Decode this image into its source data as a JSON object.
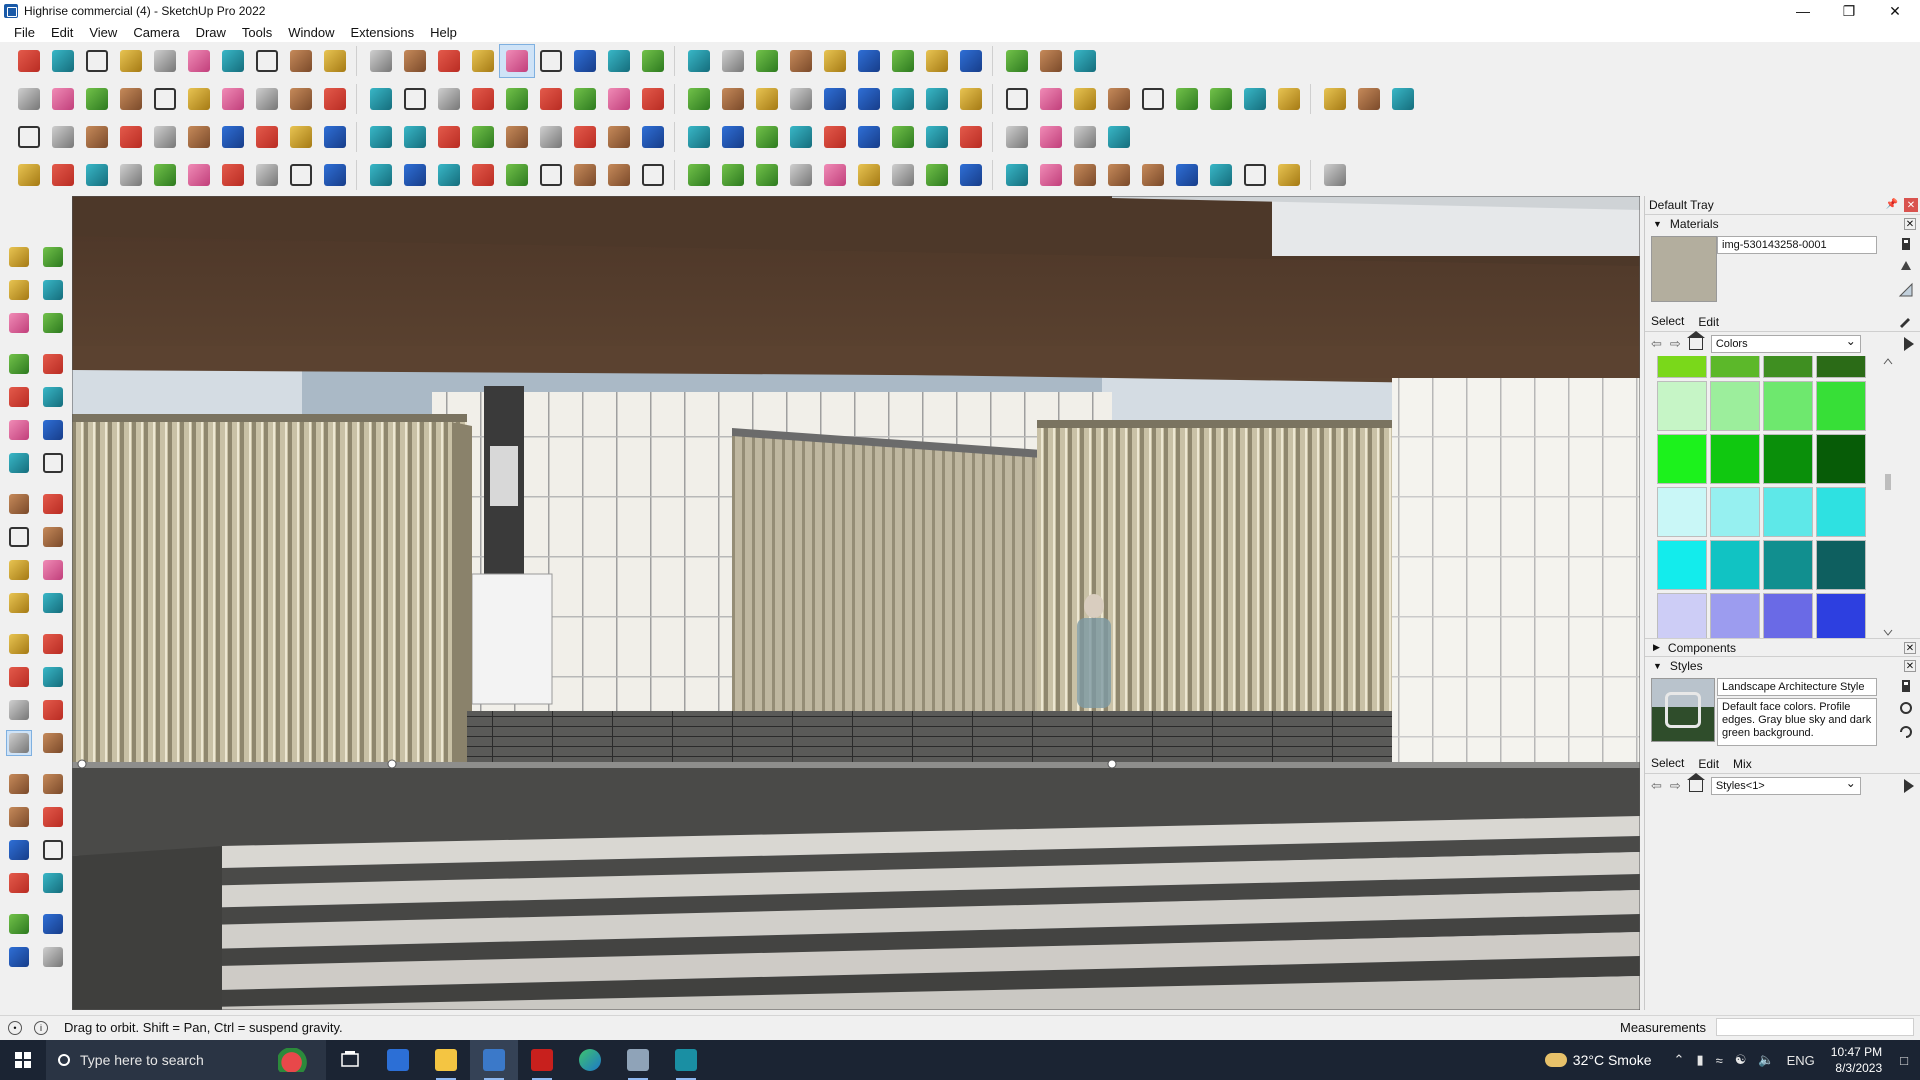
{
  "window": {
    "title": "Highrise commercial (4) - SketchUp Pro 2022",
    "controls": [
      "—",
      "❐",
      "✕"
    ]
  },
  "menu": [
    "File",
    "Edit",
    "View",
    "Camera",
    "Draw",
    "Tools",
    "Window",
    "Extensions",
    "Help"
  ],
  "toolbars": {
    "row1": [
      "zoom-icon",
      "select-icon",
      "eraser-icon",
      "pencil-icon",
      "lasso-icon",
      "paint-icon",
      "push-pull-icon",
      "follow-me-icon",
      "move-icon",
      "rotate-icon",
      "scale-icon",
      "tape-icon",
      "text-icon",
      "paint-bucket-icon",
      "orbit-icon",
      "pan-icon",
      "zoom-window-icon",
      "zoom-extents-icon",
      "section-icon",
      "layers-icon",
      "match-photo-icon",
      "sandbox-icon",
      "profile-icon",
      "component-icon",
      "group-icon",
      "flip-icon",
      "intersect-icon",
      "solid-icon",
      "undo-icon",
      "redo-icon",
      "warehouse-icon"
    ],
    "row2": [
      "iso-view-icon",
      "top-view-icon",
      "front-view-icon",
      "right-view-icon",
      "back-view-icon",
      "left-view-icon",
      "bottom-view-icon",
      "shade-icon",
      "xray-icon",
      "wire-icon",
      "hidden-icon",
      "shaded-icon",
      "textured-icon",
      "monochrome-icon",
      "move-arrow-icon",
      "axes-icon",
      "section-plane-icon",
      "house-icon",
      "roof-icon",
      "wall-icon",
      "door-icon",
      "window-icon",
      "stair-icon",
      "material-icon",
      "style-icon",
      "shadow-icon",
      "fog-icon",
      "render-icon",
      "extension-icon",
      "brush-icon",
      "shapes-icon",
      "polygon-icon",
      "circle-icon",
      "ellipse-icon",
      "parallelogram-icon",
      "arc-icon",
      "spiral-icon",
      "tag-icon",
      "link-icon",
      "draw-line-icon"
    ],
    "row3": [
      "box-icon",
      "plane-icon",
      "slab-icon",
      "beam-icon",
      "panel-icon",
      "loop-icon",
      "frame-icon",
      "door-frame-icon",
      "furniture-icon",
      "curve-icon",
      "bezier-icon",
      "add-icon",
      "weld-icon",
      "cone-icon",
      "tent-icon",
      "triangle-icon",
      "lasso-tool-icon",
      "ring-icon",
      "array-icon",
      "bucket-icon",
      "undo-arc-icon",
      "texture-icon",
      "camera-icon",
      "explode-icon",
      "label-icon",
      "grid-icon",
      "window-frame-icon",
      "tile-icon",
      "tile2-icon",
      "cross-icon",
      "arc-path-icon",
      "matrix-icon"
    ],
    "row4": [
      "spline-icon",
      "line-chain-icon",
      "car-icon",
      "scissors-icon",
      "gear-icon",
      "cloud-icon",
      "coil-icon",
      "drape-icon",
      "sphere-icon",
      "split-icon",
      "corner-icon",
      "stair-up-icon",
      "line-tool-icon",
      "curve-tool-icon",
      "stair-case-icon",
      "cut-icon",
      "columns-icon",
      "comb-icon",
      "paw-icon",
      "leaf-icon",
      "arrow-left-icon",
      "stairs2-icon",
      "slope-icon",
      "forks-icon",
      "forks2-icon",
      "fence-icon",
      "wall-hatch-icon",
      "wall2-icon",
      "louvre-icon",
      "hatch-icon",
      "grid-fence-icon",
      "louvre2-icon",
      "rail-icon",
      "wheel-icon",
      "wheel2-icon",
      "brush2-icon",
      "forks3-icon",
      "globe-icon"
    ]
  },
  "left_palette": [
    [
      "select-icon",
      "orbit-icon"
    ],
    [
      "paint-icon",
      "eraser-icon"
    ],
    [
      "component-icon",
      "tag-icon"
    ],
    [
      "line-icon",
      "freehand-icon"
    ],
    [
      "rectangle-icon",
      "rotated-rect-icon"
    ],
    [
      "circle-icon",
      "polygon-icon"
    ],
    [
      "arc-icon",
      "arc2-icon"
    ],
    [
      "pie-icon",
      "arc3-icon"
    ],
    [
      "move-icon",
      "push-pull-icon"
    ],
    [
      "rotate-icon",
      "follow-me-icon"
    ],
    [
      "scale-icon",
      "offset-icon"
    ],
    [
      "tape-icon",
      "dimension-icon"
    ],
    [
      "protractor-icon",
      "text-icon"
    ],
    [
      "axes-icon",
      "3d-text-icon"
    ],
    [
      "orbit-active-icon",
      "pan-icon"
    ],
    [
      "zoom-icon",
      "zoom-window-icon"
    ],
    [
      "zoom-extents-icon",
      "previous-view-icon"
    ],
    [
      "position-camera-icon",
      "look-around-icon"
    ],
    [
      "walk-icon",
      "section-icon"
    ],
    [
      "section-display-icon",
      "section-cut-icon"
    ],
    [
      "section-fill-icon",
      "section-fill2-icon"
    ]
  ],
  "tray": {
    "title": "Default Tray",
    "materials": {
      "title": "Materials",
      "name": "img-530143258-0001",
      "swatch": "#b3ae9e",
      "tabs": [
        "Select",
        "Edit"
      ],
      "library": "Colors",
      "colors": [
        "#7ad81a",
        "#5cb82a",
        "#3f8f21",
        "#2b6b17",
        "#c6f5c6",
        "#9cee9c",
        "#6ee86e",
        "#37df37",
        "#1cf21c",
        "#10c810",
        "#0a8f0a",
        "#075c07",
        "#c9f7f7",
        "#96f0f0",
        "#5ee8e8",
        "#2ee1e1",
        "#13ecec",
        "#11c3c3",
        "#118f8f",
        "#0e5f5f",
        "#cdcdf6",
        "#9c9cef",
        "#6a6ae6",
        "#2d3fe0"
      ]
    },
    "components": {
      "title": "Components"
    },
    "styles": {
      "title": "Styles",
      "name": "Landscape Architecture Style",
      "description": "Default face colors. Profile edges. Gray blue sky and dark green background.",
      "tabs": [
        "Select",
        "Edit",
        "Mix"
      ],
      "library": "Styles<1>"
    }
  },
  "status": {
    "hint": "Drag to orbit. Shift = Pan, Ctrl = suspend gravity.",
    "measurements_label": "Measurements"
  },
  "taskbar": {
    "search_placeholder": "Type here to search",
    "apps": [
      "task-view-icon",
      "calculator-icon",
      "file-explorer-icon",
      "sketchup-icon",
      "acrobat-icon",
      "edge-icon",
      "snipping-icon",
      "app-3-icon"
    ],
    "weather": "32°C  Smoke",
    "lang": "ENG",
    "time": "10:47 PM",
    "date": "8/3/2023"
  }
}
